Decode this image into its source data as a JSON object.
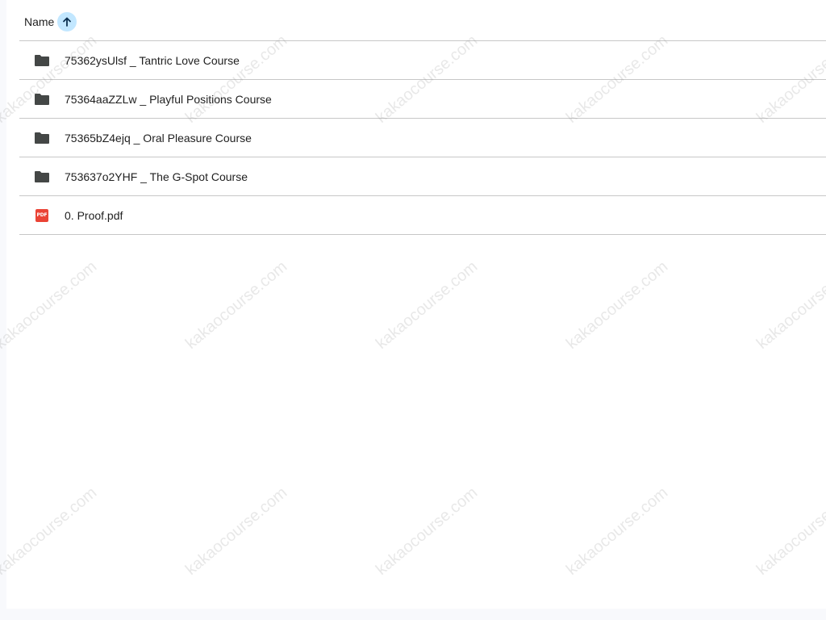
{
  "list_header": {
    "name_label": "Name",
    "sort_direction": "ascending",
    "sort_icon": "arrow-up-icon"
  },
  "items": [
    {
      "type": "folder",
      "icon": "folder-icon",
      "name": "75362ysUlsf _ Tantric Love Course"
    },
    {
      "type": "folder",
      "icon": "folder-icon",
      "name": "75364aaZZLw _ Playful Positions Course"
    },
    {
      "type": "folder",
      "icon": "folder-icon",
      "name": "75365bZ4ejq _ Oral Pleasure Course"
    },
    {
      "type": "folder",
      "icon": "folder-icon",
      "name": "753637o2YHF _ The G-Spot Course"
    },
    {
      "type": "pdf",
      "icon": "pdf-icon",
      "icon_text": "PDF",
      "name": "0. Proof.pdf"
    }
  ],
  "watermark": {
    "text": "kakaocourse.com"
  },
  "colors": {
    "sort_badge": "#c2e7ff",
    "folder": "#444746",
    "pdf": "#ea4335",
    "divider": "#c7c7c7"
  }
}
